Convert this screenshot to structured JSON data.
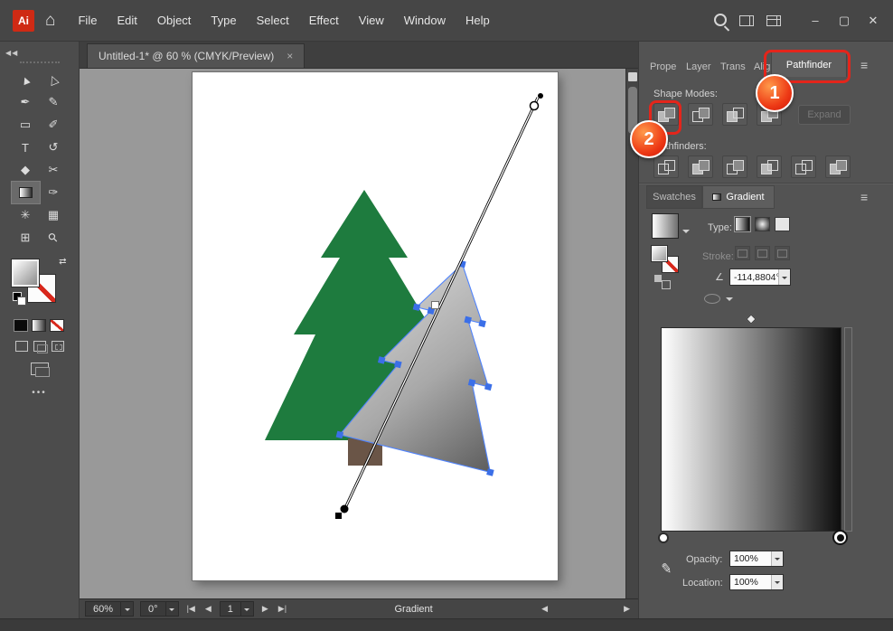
{
  "window": {
    "minimize": "–",
    "maximize": "▢",
    "close": "✕"
  },
  "titlebar": {
    "logo": "Ai",
    "menus": [
      "File",
      "Edit",
      "Object",
      "Type",
      "Select",
      "Effect",
      "View",
      "Window",
      "Help"
    ]
  },
  "doc_tab": {
    "title": "Untitled-1* @ 60 % (CMYK/Preview)",
    "close": "×"
  },
  "toolbar": {
    "collapse": "◀◀",
    "more": "•••",
    "tools": [
      {
        "name": "selection-tool",
        "glyph": "▲"
      },
      {
        "name": "direct-selection-tool",
        "glyph": "△"
      },
      {
        "name": "pen-tool",
        "glyph": "✒"
      },
      {
        "name": "pencil-tool",
        "glyph": "✎"
      },
      {
        "name": "rectangle-tool",
        "glyph": "▭"
      },
      {
        "name": "paintbrush-tool",
        "glyph": "✐"
      },
      {
        "name": "type-tool",
        "glyph": "T"
      },
      {
        "name": "rotate-tool",
        "glyph": "↺"
      },
      {
        "name": "eraser-tool",
        "glyph": "◆"
      },
      {
        "name": "scissors-tool",
        "glyph": "✂"
      },
      {
        "name": "gradient-tool",
        "glyph": ""
      },
      {
        "name": "eyedropper-tool",
        "glyph": "✑"
      },
      {
        "name": "symbol-sprayer-tool",
        "glyph": "✳"
      },
      {
        "name": "graph-tool",
        "glyph": "▦"
      },
      {
        "name": "artboard-tool",
        "glyph": "⊞"
      },
      {
        "name": "zoom-tool",
        "glyph": "⚲"
      }
    ]
  },
  "pathfinder": {
    "tabs": [
      "Prope",
      "Layer",
      "Trans",
      "Alig"
    ],
    "active_tab": "Pathfinder",
    "shape_modes_label": "Shape Modes:",
    "expand_label": "Expand",
    "pathfinders_label": "Pathfinders:",
    "shape_mode_icons": [
      "unite",
      "minus-front",
      "intersect",
      "exclude"
    ],
    "pathfinder_icons": [
      "divide",
      "trim",
      "merge",
      "crop",
      "outline",
      "minus-back"
    ]
  },
  "gradient_panel": {
    "tab_swatches": "Swatches",
    "tab_gradient": "Gradient",
    "type_label": "Type:",
    "stroke_label": "Stroke:",
    "angle_value": "-114,8804°",
    "opacity_label": "Opacity:",
    "opacity_value": "100%",
    "location_label": "Location:",
    "location_value": "100%"
  },
  "statusbar": {
    "zoom": "60%",
    "rotation": "0°",
    "artboard": "1",
    "nav_first": "|◀",
    "nav_prev": "◀",
    "nav_next": "▶",
    "nav_last": "▶|",
    "tool_label": "Gradient"
  },
  "annotations": {
    "step1": "1",
    "step2": "2",
    "highlight_color": "#e4251b"
  },
  "ui": {
    "hamburger": "≡",
    "swap": "⇄",
    "angle_icon": "∠"
  },
  "colors": {
    "tree_green": "#1e7b3e",
    "trunk_brown": "#6a5547",
    "selection_blue": "#4f83ff",
    "annotation_red": "#e4251b",
    "panel_gray": "#535353",
    "pasteboard_gray": "#999999"
  }
}
